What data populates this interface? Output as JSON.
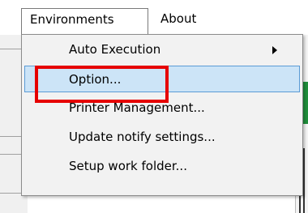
{
  "menubar": {
    "items": [
      {
        "label": "Environments",
        "open": true
      },
      {
        "label": "About",
        "open": false
      }
    ]
  },
  "dropdown": {
    "items": [
      {
        "label": "Auto Execution",
        "has_submenu": true
      },
      {
        "label": "Option...",
        "highlighted": true
      },
      {
        "label": "Printer Management..."
      },
      {
        "label": "Update notify settings..."
      },
      {
        "label": "Setup work folder..."
      }
    ]
  },
  "annotation": {
    "color": "#e60000",
    "target": "Option..."
  },
  "colors": {
    "highlight_bg": "#cce4f7",
    "highlight_border": "#5b9bd5",
    "menu_bg": "#f2f2f2"
  }
}
